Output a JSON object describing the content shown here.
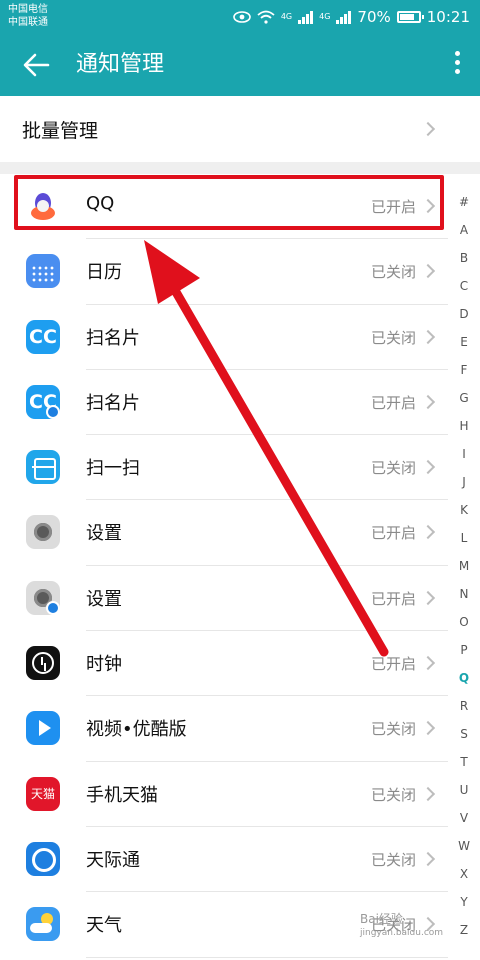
{
  "status_bar": {
    "carrier_1": "中国电信",
    "carrier_2": "中国联通",
    "net_1": "4G",
    "net_2": "4G",
    "battery": "70%",
    "time": "10:21"
  },
  "app_bar": {
    "title": "通知管理"
  },
  "batch": {
    "label": "批量管理"
  },
  "apps": [
    {
      "name": "QQ",
      "state": "已开启",
      "icon": "qq-penguin-icon"
    },
    {
      "name": "日历",
      "state": "已关闭",
      "icon": "calendar-icon"
    },
    {
      "name": "扫名片",
      "state": "已关闭",
      "icon": "card-scan-icon",
      "clone": false
    },
    {
      "name": "扫名片",
      "state": "已开启",
      "icon": "card-scan-icon",
      "clone": true
    },
    {
      "name": "扫一扫",
      "state": "已关闭",
      "icon": "scan-icon"
    },
    {
      "name": "设置",
      "state": "已开启",
      "icon": "settings-gear-icon",
      "clone": false
    },
    {
      "name": "设置",
      "state": "已开启",
      "icon": "settings-gear-icon",
      "clone": true
    },
    {
      "name": "时钟",
      "state": "已开启",
      "icon": "clock-icon"
    },
    {
      "name": "视频•优酷版",
      "state": "已关闭",
      "icon": "video-play-icon"
    },
    {
      "name": "手机天猫",
      "state": "已关闭",
      "icon": "tmall-icon",
      "icon_text": "天猫"
    },
    {
      "name": "天际通",
      "state": "已关闭",
      "icon": "globe-icon"
    },
    {
      "name": "天气",
      "state": "已关闭",
      "icon": "weather-icon"
    }
  ],
  "index_letters": [
    "#",
    "A",
    "B",
    "C",
    "D",
    "E",
    "F",
    "G",
    "H",
    "I",
    "J",
    "K",
    "L",
    "M",
    "N",
    "O",
    "P",
    "Q",
    "R",
    "S",
    "T",
    "U",
    "V",
    "W",
    "X",
    "Y",
    "Z"
  ],
  "index_active": "Q",
  "watermark": {
    "line_1": "Bai经验",
    "line_2": "jingyan.baidu.com"
  },
  "colors": {
    "accent": "#1aa5ae",
    "highlight": "#e0101c",
    "state_text": "#8a8a8a"
  }
}
